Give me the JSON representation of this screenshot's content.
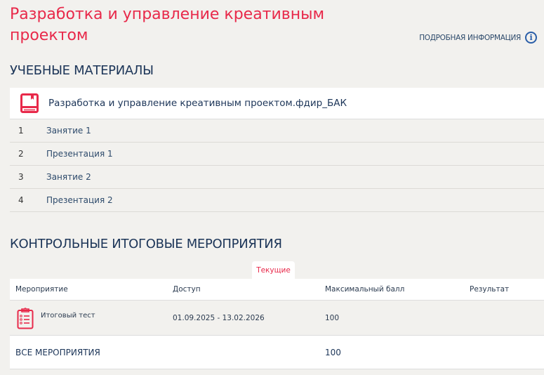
{
  "header": {
    "title": "Разработка и управление креативным проектом",
    "more_info": "ПОДРОБНАЯ ИНФОРМАЦИЯ"
  },
  "materials": {
    "heading": "УЧЕБНЫЕ МАТЕРИАЛЫ",
    "course": "Разработка и управление креативным проектом.фдир_БАК",
    "items": [
      {
        "n": "1",
        "label": "Занятие 1"
      },
      {
        "n": "2",
        "label": "Презентация 1"
      },
      {
        "n": "3",
        "label": "Занятие 2"
      },
      {
        "n": "4",
        "label": "Презентация 2"
      }
    ]
  },
  "events": {
    "heading": "КОНТРОЛЬНЫЕ ИТОГОВЫЕ МЕРОПРИЯТИЯ",
    "tab": "Текущие",
    "columns": [
      "Мероприятие",
      "Доступ",
      "Максимальный балл",
      "Результат"
    ],
    "rows": [
      {
        "name": "Итоговый тест",
        "access": "01.09.2025 - 13.02.2026",
        "max": "100",
        "result": ""
      }
    ],
    "total": {
      "label": "ВСЕ МЕРОПРИЯТИЯ",
      "max": "100"
    }
  },
  "colors": {
    "accent": "#e8294a",
    "navy": "#1c3558"
  }
}
